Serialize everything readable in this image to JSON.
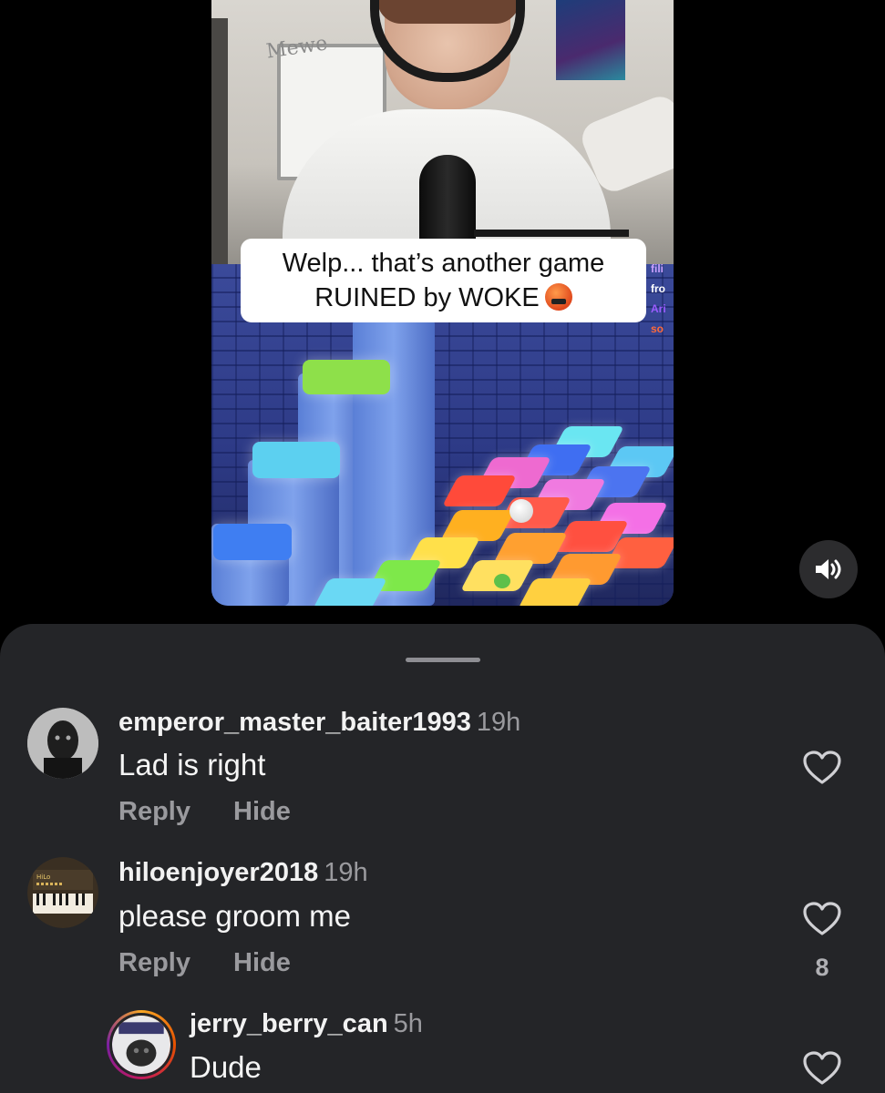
{
  "video": {
    "caption_line1": "Welp... that’s another game",
    "caption_line2": "RUINED by WOKE",
    "caption_emoji": "face-with-symbols-on-mouth",
    "board_scribble": "Mewe",
    "chat_overlay": [
      "fili",
      "fro",
      "Ari",
      "so"
    ]
  },
  "mute_button": {
    "icon": "speaker-on-icon"
  },
  "comments": [
    {
      "username": "emperor_master_baiter1993",
      "time": "19h",
      "text": "Lad is right",
      "reply_label": "Reply",
      "hide_label": "Hide",
      "like_count": ""
    },
    {
      "username": "hiloenjoyer2018",
      "time": "19h",
      "text": "please groom me",
      "reply_label": "Reply",
      "hide_label": "Hide",
      "like_count": "8"
    },
    {
      "username": "jerry_berry_can",
      "time": "5h",
      "text": "Dude",
      "reply_label": "",
      "hide_label": "",
      "like_count": ""
    }
  ],
  "colors": {
    "sheet_bg": "#242528",
    "text_primary": "#f5f5f5",
    "text_secondary": "#9a9a9e",
    "story_ring_start": "#f9a825",
    "story_ring_end": "#c2185b"
  }
}
